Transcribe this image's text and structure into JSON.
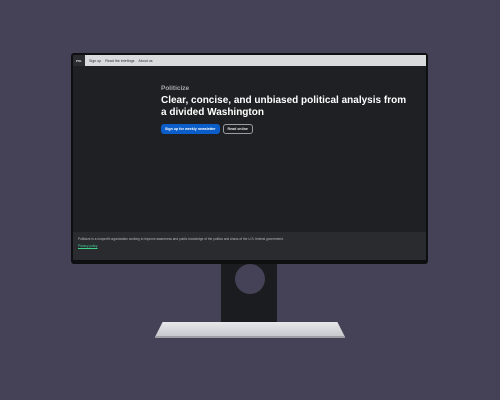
{
  "navbar": {
    "logo_text": "POL",
    "links": [
      "Sign up",
      "Read the briefings",
      "About us"
    ]
  },
  "hero": {
    "brand": "Politicize",
    "headline": "Clear, concise, and unbiased political analysis from a divided Washington",
    "primary_button": "Sign up for weekly newsletter",
    "secondary_button": "Read online"
  },
  "footer": {
    "description": "Politicize is a nonprofit organization working to improve awareness and public knowledge of the politics and chaos of the U.S. federal government.",
    "link": "Privacy policy"
  },
  "colors": {
    "background": "#454257",
    "screen_bg": "#1f2023",
    "primary": "#0b5ec9",
    "footer_link": "#3fd08a"
  }
}
